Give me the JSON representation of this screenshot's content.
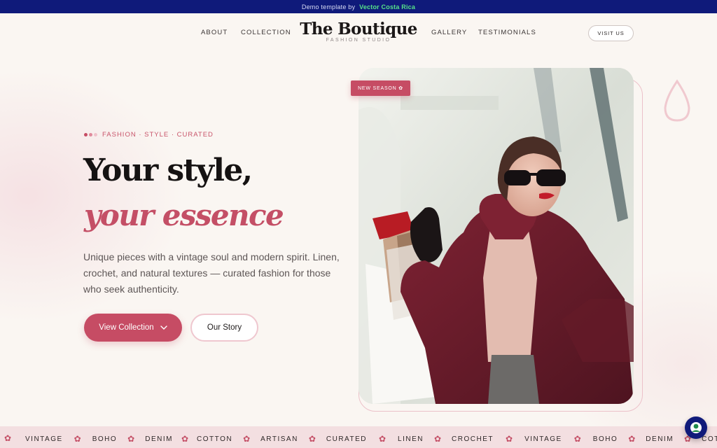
{
  "topbar": {
    "prefix": "Demo template by",
    "brand": "Vector Costa Rica"
  },
  "header": {
    "nav_left": [
      "ABOUT",
      "COLLECTION"
    ],
    "nav_right": [
      "GALLERY",
      "TESTIMONIALS"
    ],
    "logo_title": "The Boutique",
    "logo_subtitle": "FASHION STUDIO",
    "cta": "VISIT US"
  },
  "hero": {
    "eyebrow": "FASHION · STYLE · CURATED",
    "headline_line1": "Your style,",
    "headline_line2": "your essence",
    "lead": "Unique pieces with a vintage soul and modern spirit. Linen, crochet, and natural textures — curated fashion for those who seek authenticity.",
    "primary_button": "View Collection",
    "secondary_button": "Our Story",
    "badge": "NEW SEASON ✿"
  },
  "marquee": [
    "VINTAGE",
    "BOHO",
    "DENIM",
    "COTTON",
    "ARTISAN",
    "CURATED",
    "LINEN",
    "CROCHET",
    "VINTAGE",
    "BOHO",
    "DENIM",
    "COTTO"
  ],
  "colors": {
    "accent": "#c64c64",
    "topbar": "#0f1a7a",
    "background": "#faf6f2",
    "marquee": "#f3dfe1"
  },
  "icons": {
    "button_chevron": "chevron-down-icon",
    "marquee_separator": "flower-icon",
    "chat": "chat-widget-icon"
  }
}
